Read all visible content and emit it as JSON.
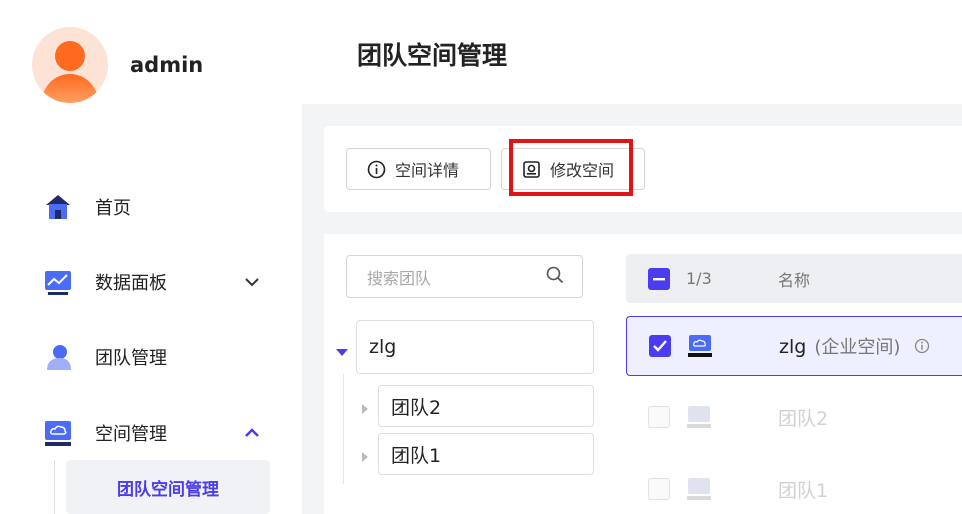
{
  "user": {
    "name": "admin"
  },
  "sidebar": {
    "items": [
      {
        "label": "首页",
        "icon": "home-icon"
      },
      {
        "label": "数据面板",
        "icon": "chart-icon",
        "expanded": false
      },
      {
        "label": "团队管理",
        "icon": "team-icon"
      },
      {
        "label": "空间管理",
        "icon": "cloud-storage-icon",
        "expanded": true
      }
    ],
    "sub_active": "团队空间管理"
  },
  "header": {
    "title": "团队空间管理"
  },
  "toolbar": {
    "details_label": "空间详情",
    "edit_label": "修改空间"
  },
  "search": {
    "placeholder": "搜索团队"
  },
  "tree": {
    "root": "zlg",
    "children": [
      "团队2",
      "团队1"
    ]
  },
  "table": {
    "count": "1/3",
    "name_header": "名称",
    "rows": [
      {
        "name": "zlg",
        "tag": "(企业空间)",
        "selected": true
      },
      {
        "name": "团队2",
        "tag": "",
        "selected": false
      },
      {
        "name": "团队1",
        "tag": "",
        "selected": false
      }
    ]
  },
  "colors": {
    "accent": "#4a3cf0",
    "highlight": "#e01414",
    "avatar": "#ff6a1f"
  }
}
